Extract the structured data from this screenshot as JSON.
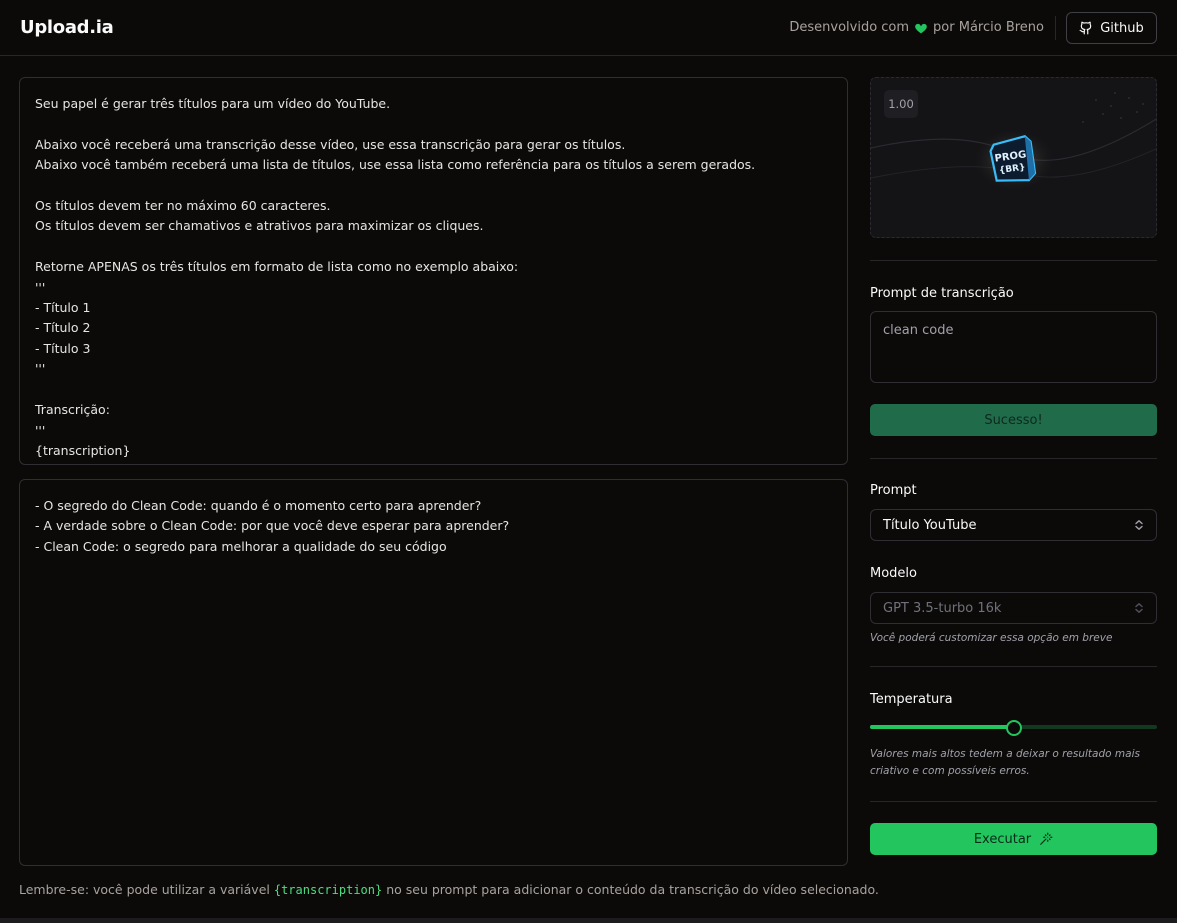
{
  "header": {
    "logo": "Upload.ia",
    "credit_prefix": "Desenvolvido com",
    "credit_suffix": "por Márcio Breno",
    "github_label": "Github",
    "heart_color": "#22c55e"
  },
  "editor": {
    "prompt_text": "Seu papel é gerar três títulos para um vídeo do YouTube.\n\nAbaixo você receberá uma transcrição desse vídeo, use essa transcrição para gerar os títulos.\nAbaixo você também receberá uma lista de títulos, use essa lista como referência para os títulos a serem gerados.\n\nOs títulos devem ter no máximo 60 caracteres.\nOs títulos devem ser chamativos e atrativos para maximizar os cliques.\n\nRetorne APENAS os três títulos em formato de lista como no exemplo abaixo:\n'''\n- Título 1\n- Título 2\n- Título 3\n'''\n\nTranscrição:\n'''\n{transcription}",
    "result_text": "- O segredo do Clean Code: quando é o momento certo para aprender?\n- A verdade sobre o Clean Code: por que você deve esperar para aprender?\n- Clean Code: o segredo para melhorar a qualidade do seu código",
    "hint_before": "Lembre-se: você pode utilizar a variável",
    "hint_code": "{transcription}",
    "hint_after": "no seu prompt para adicionar o conteúdo da transcrição do vídeo selecionado."
  },
  "sidebar": {
    "video": {
      "zoom": "1.00",
      "logo_text_line1": "PROG",
      "logo_text_line2": "{BR}"
    },
    "transcription_label": "Prompt de transcrição",
    "transcription_value": "clean code",
    "success_label": "Sucesso!",
    "prompt_label": "Prompt",
    "prompt_value": "Título YouTube",
    "model_label": "Modelo",
    "model_value": "GPT 3.5-turbo 16k",
    "model_note": "Você poderá customizar essa opção em breve",
    "temperature_label": "Temperatura",
    "temperature_value": 0.5,
    "temperature_note": "Valores mais altos tedem a deixar o resultado mais criativo e com possíveis erros.",
    "run_label": "Executar"
  },
  "colors": {
    "accent": "#22c55e",
    "background": "#0c0a09",
    "border": "#27272a",
    "success_button": "#1f6b4a"
  },
  "icons": [
    "heart-icon",
    "github-icon",
    "chevron-updown-icon",
    "magic-wand-icon"
  ]
}
